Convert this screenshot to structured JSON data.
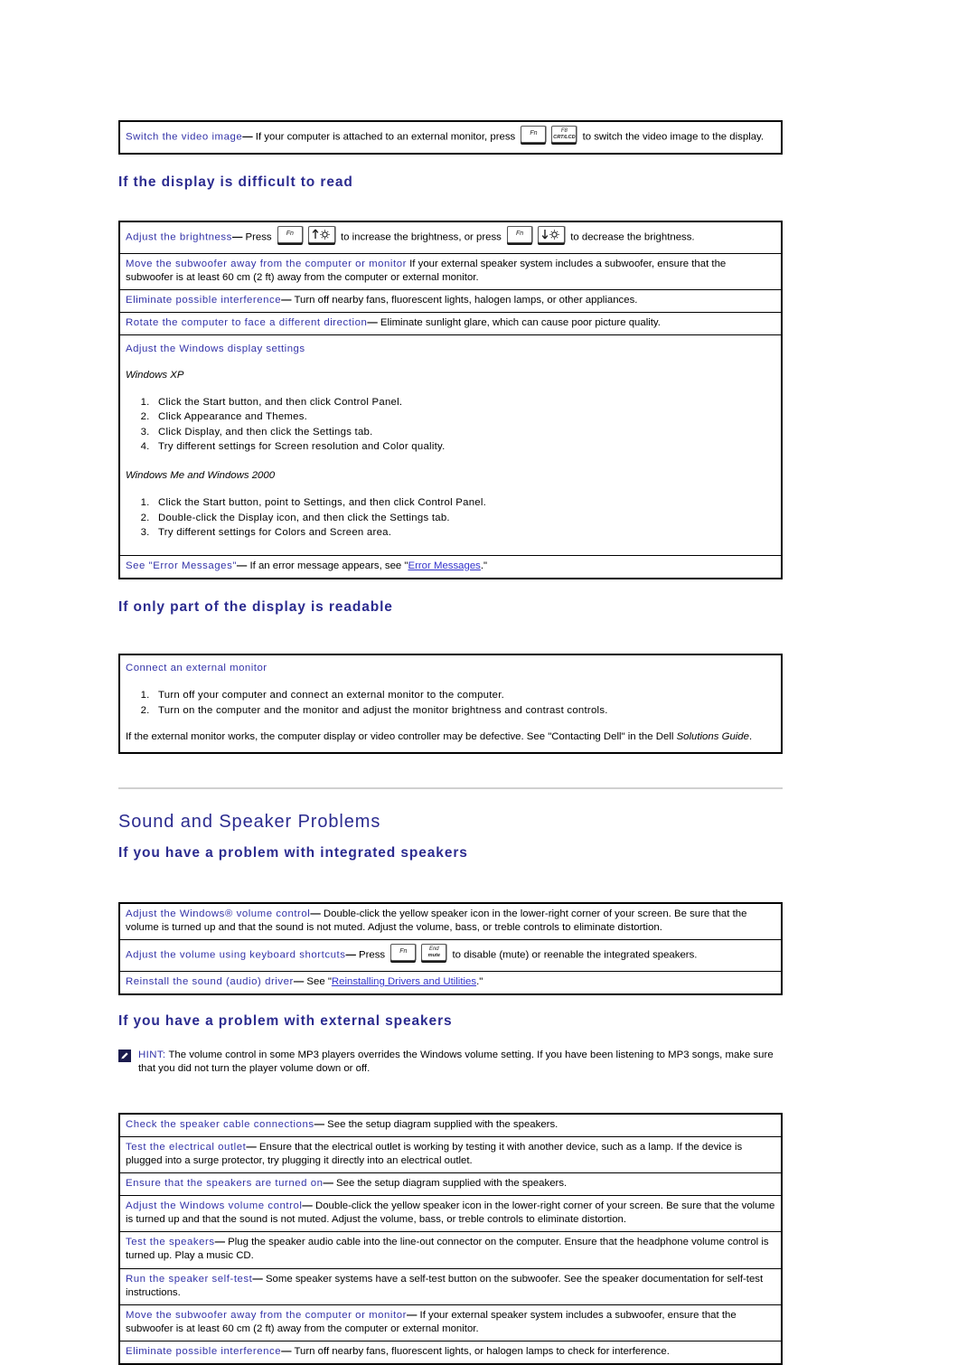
{
  "page": {
    "top_tip": {
      "lead": "Switch the video image",
      "dash": "—",
      "body_before_keys": " If your computer is attached to an external monitor, press ",
      "keys": [
        {
          "name": "fn-key",
          "label": "Fn",
          "type": "text"
        },
        {
          "name": "f8-crt-lcd-key",
          "label": "F8",
          "sublabel": "CRT/LCD",
          "type": "two-line"
        }
      ],
      "body_after_keys": " to switch the video image to the display."
    },
    "heading_display_difficult": "If the display is difficult to read",
    "heading_part_readable": "If only part of the display is readable",
    "heading_sound_speaker": "Sound and Speaker Problems",
    "heading_integrated_speakers": "If you have a problem with integrated speakers",
    "heading_external_speakers": "If you have a problem with external speakers"
  },
  "display_tips": {
    "brightness": {
      "lead": "Adjust the brightness",
      "dash": "—",
      "part1": " Press ",
      "keys1": [
        {
          "name": "fn-key",
          "label": "Fn",
          "type": "text"
        },
        {
          "name": "brightness-up-key",
          "label": "",
          "type": "glyph-up"
        }
      ],
      "part2": " to increase the brightness, or press ",
      "keys2": [
        {
          "name": "fn-key",
          "label": "Fn",
          "type": "text"
        },
        {
          "name": "brightness-down-key",
          "label": "",
          "type": "glyph-down"
        }
      ],
      "part3": " to decrease the brightness."
    },
    "subwoofer": {
      "lead": "Move the subwoofer away from the computer or monitor",
      "dash": "",
      "body": " If your external speaker system includes a subwoofer, ensure that the subwoofer is at least 60 cm (2 ft) away from the computer or external monitor."
    },
    "interference": {
      "lead": "Eliminate possible interference",
      "dash": "—",
      "body": " Turn off nearby fans, fluorescent lights, halogen lamps, or other appliances."
    },
    "rotate": {
      "lead": "Rotate the computer to face a different direction",
      "dash": "—",
      "body": " Eliminate sunlight glare, which can cause poor picture quality."
    },
    "windows_display_settings": {
      "lead": "Adjust the Windows display settings",
      "os_xp": "Windows XP",
      "steps_xp": [
        "Click the Start button, and then click Control Panel.",
        "Click Appearance and Themes.",
        "Click Display, and then click the Settings tab.",
        "Try different settings for Screen resolution and Color quality."
      ],
      "os_me2000": "Windows Me and Windows 2000",
      "steps_me2000": [
        "Click the Start button, point to Settings, and then click Control Panel.",
        "Double-click the Display icon, and then click the Settings tab.",
        "Try different settings for Colors and Screen area."
      ]
    },
    "error_messages": {
      "lead": "See \"Error Messages\"",
      "dash": "—",
      "part1": " If an error message appears, see \"",
      "link": "Error Messages",
      "part2": ".\""
    }
  },
  "external_monitor_box": {
    "lead": "Connect an external monitor",
    "steps": [
      "Turn off your computer and connect an external monitor to the computer.",
      "Turn on the computer and the monitor and adjust the monitor brightness and contrast controls."
    ],
    "note_part1": "If the external monitor works, the computer display or video controller may be defective. See \"Contacting Dell\" in the Dell ",
    "note_italic": "Solutions Guide",
    "note_part2": "."
  },
  "integrated_speaker_tips": {
    "windows_volume": {
      "lead": "Adjust the Windows® volume control",
      "dash": "—",
      "body": " Double-click the yellow speaker icon in the lower-right corner of your screen. Be sure that the volume is turned up and that the sound is not muted. Adjust the volume, bass, or treble controls to eliminate distortion."
    },
    "keyboard_shortcuts": {
      "lead": "Adjust the volume using keyboard shortcuts",
      "dash": "—",
      "part1": " Press ",
      "keys": [
        {
          "name": "fn-key",
          "label": "Fn",
          "type": "text"
        },
        {
          "name": "end-mute-key",
          "label": "End",
          "sublabel": "mute",
          "type": "two-line"
        }
      ],
      "part2": " to disable (mute) or reenable the integrated speakers."
    },
    "reinstall_driver": {
      "lead": "Reinstall the sound (audio) driver",
      "dash": "—",
      "part1": " See \"",
      "link": "Reinstalling Drivers and Utilities",
      "part2": ".\""
    }
  },
  "hint": {
    "icon": "note-pencil-icon",
    "word": "HINT:",
    "text": " The volume control in some MP3 players overrides the Windows volume setting. If you have been listening to MP3 songs, make sure that you did not turn the player volume down or off."
  },
  "external_speaker_tips": [
    {
      "name": "check-speaker-cable-connections",
      "lead": "Check the speaker cable connections",
      "dash": "—",
      "body": " See the setup diagram supplied with the speakers."
    },
    {
      "name": "test-the-electrical-outlet",
      "lead": "Test the electrical outlet",
      "dash": "—",
      "body": " Ensure that the electrical outlet is working by testing it with another device, such as a lamp. If the device is plugged into a surge protector, try plugging it directly into an electrical outlet."
    },
    {
      "name": "ensure-speakers-turned-on",
      "lead": "Ensure that the speakers are turned on",
      "dash": "—",
      "body": " See the setup diagram supplied with the speakers."
    },
    {
      "name": "adjust-windows-volume-control",
      "lead": "Adjust the Windows volume control",
      "dash": "—",
      "body": " Double-click the yellow speaker icon in the lower-right corner of your screen. Be sure that the volume is turned up and that the sound is not muted. Adjust the volume, bass, or treble controls to eliminate distortion."
    },
    {
      "name": "test-the-speakers",
      "lead": "Test the speakers",
      "dash": "—",
      "body": " Plug the speaker audio cable into the line-out connector on the computer. Ensure that the headphone volume control is turned up. Play a music CD."
    },
    {
      "name": "run-the-speaker-self-test",
      "lead": "Run the speaker self-test",
      "dash": "—",
      "body": " Some speaker systems have a self-test button on the subwoofer. See the speaker documentation for self-test instructions."
    },
    {
      "name": "move-subwoofer-away",
      "lead": "Move the subwoofer away from the computer or monitor",
      "dash": "—",
      "body": " If your external speaker system includes a subwoofer, ensure that the subwoofer is at least 60 cm (2 ft) away from the computer or external monitor."
    },
    {
      "name": "eliminate-possible-interference",
      "lead": "Eliminate possible interference",
      "dash": "—",
      "body": " Turn off nearby fans, fluorescent lights, or halogen lamps to check for interference."
    }
  ],
  "colors": {
    "heading_blue": "#2b2b8f",
    "lead_blue": "#3333a8",
    "link_blue": "#3333cc",
    "rule_gray": "#d0d0d0"
  }
}
